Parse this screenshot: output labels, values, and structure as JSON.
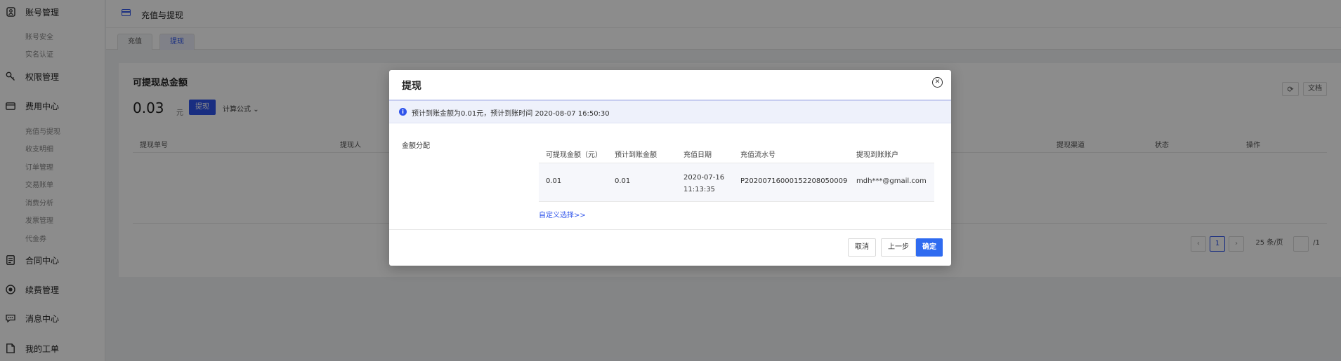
{
  "sidebar": {
    "groups": [
      {
        "label": "账号管理",
        "icon": "account-icon",
        "subs": [
          "账号安全",
          "实名认证"
        ]
      },
      {
        "label": "权限管理",
        "icon": "key-icon",
        "subs": []
      },
      {
        "label": "费用中心",
        "icon": "card-icon",
        "subs": [
          "充值与提现",
          "收支明细",
          "订单管理",
          "交易账单",
          "消费分析",
          "发票管理",
          "代金券"
        ]
      },
      {
        "label": "合同中心",
        "icon": "contract-icon",
        "subs": []
      },
      {
        "label": "续费管理",
        "icon": "renew-icon",
        "subs": []
      },
      {
        "label": "消息中心",
        "icon": "message-icon",
        "subs": []
      },
      {
        "label": "我的工单",
        "icon": "ticket-icon",
        "subs": []
      }
    ]
  },
  "header": {
    "title": "充值与提现"
  },
  "tabs": [
    {
      "label": "充值"
    },
    {
      "label": "提现"
    }
  ],
  "main": {
    "card_title": "可提现总金额",
    "amount": "0.03",
    "unit": "元",
    "withdraw_label": "提现",
    "formula_label": "计算公式",
    "refresh_icon": "refresh-icon",
    "doc_label": "文档",
    "columns": [
      "提现单号",
      "提现人",
      "提现渠道",
      "状态",
      "操作"
    ],
    "pagination": {
      "current": "1",
      "page_size": "25 条/页",
      "total_pages": "/1"
    }
  },
  "modal": {
    "title": "提现",
    "alert": "预计到账金额为0.01元，预计到账时间 2020-08-07 16:50:30",
    "section_label": "金额分配",
    "columns": [
      "可提现金额（元）",
      "预计到账金额",
      "充值日期",
      "充值流水号",
      "提现到账账户"
    ],
    "row": {
      "withdrawable": "0.01",
      "expected": "0.01",
      "date_line1": "2020-07-16",
      "date_line2": "11:13:35",
      "serial": "P2020071600015220805000 9",
      "account": "mdh***@gmail.com"
    },
    "custom_link": "自定义选择>>",
    "buttons": {
      "cancel": "取消",
      "prev": "上一步",
      "confirm": "确定"
    }
  }
}
